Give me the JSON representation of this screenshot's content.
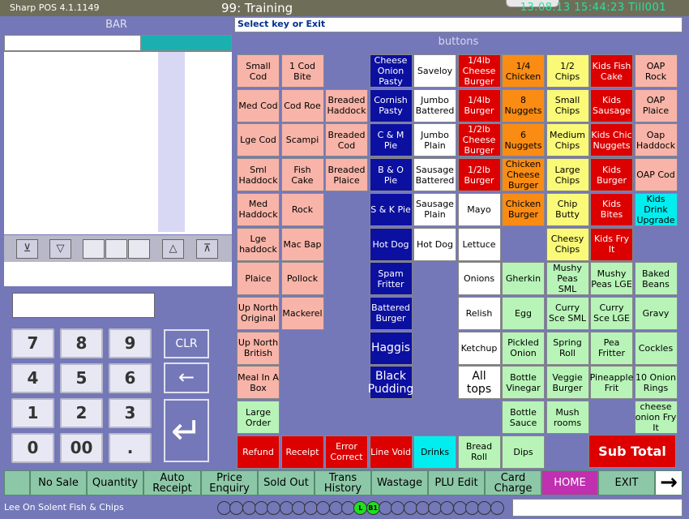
{
  "titlebar": {
    "app": "Sharp POS 4.1.1149",
    "title": "99: Training",
    "clock": "13.08.13  15:44:23  Till001"
  },
  "left": {
    "bar_label": "BAR",
    "scroll_buttons": [
      "top",
      "down",
      "",
      "",
      "",
      "up",
      "bottom"
    ],
    "keypad": [
      "7",
      "8",
      "9",
      "4",
      "5",
      "6",
      "1",
      "2",
      "3",
      "0",
      "00",
      "."
    ],
    "clr_label": "CLR",
    "backspace_label": "←",
    "enter_label": "↵"
  },
  "status": {
    "prompt": "Select key or Exit"
  },
  "buttons_label": "buttons",
  "buttons": [
    {
      "label": "Small Cod",
      "color": "pink",
      "col": 0,
      "row": 0
    },
    {
      "label": "1 Cod Bite",
      "color": "pink",
      "col": 1,
      "row": 0
    },
    {
      "label": "Cheese Onion Pasty",
      "color": "navy",
      "col": 3,
      "row": 0
    },
    {
      "label": "Saveloy",
      "color": "white",
      "col": 4,
      "row": 0
    },
    {
      "label": "1/4lb Cheese Burger",
      "color": "red",
      "col": 5,
      "row": 0
    },
    {
      "label": "1/4 Chicken",
      "color": "orange",
      "col": 6,
      "row": 0
    },
    {
      "label": "1/2 Chips",
      "color": "yellow",
      "col": 7,
      "row": 0
    },
    {
      "label": "Kids Fish Cake",
      "color": "red",
      "col": 8,
      "row": 0
    },
    {
      "label": "OAP Rock",
      "color": "pink",
      "col": 9,
      "row": 0
    },
    {
      "label": "Med Cod",
      "color": "pink",
      "col": 0,
      "row": 1
    },
    {
      "label": "Cod Roe",
      "color": "pink",
      "col": 1,
      "row": 1
    },
    {
      "label": "Breaded Haddock",
      "color": "pink",
      "col": 2,
      "row": 1
    },
    {
      "label": "Cornish Pasty",
      "color": "navy",
      "col": 3,
      "row": 1
    },
    {
      "label": "Jumbo Battered",
      "color": "white",
      "col": 4,
      "row": 1
    },
    {
      "label": "1/4lb Burger",
      "color": "red",
      "col": 5,
      "row": 1
    },
    {
      "label": "8 Nuggets",
      "color": "orange",
      "col": 6,
      "row": 1
    },
    {
      "label": "Small Chips",
      "color": "yellow",
      "col": 7,
      "row": 1
    },
    {
      "label": "Kids Sausage",
      "color": "red",
      "col": 8,
      "row": 1
    },
    {
      "label": "OAP Plaice",
      "color": "pink",
      "col": 9,
      "row": 1
    },
    {
      "label": "Lge Cod",
      "color": "pink",
      "col": 0,
      "row": 2
    },
    {
      "label": "Scampi",
      "color": "pink",
      "col": 1,
      "row": 2
    },
    {
      "label": "Breaded Cod",
      "color": "pink",
      "col": 2,
      "row": 2
    },
    {
      "label": "C & M Pie",
      "color": "navy",
      "col": 3,
      "row": 2
    },
    {
      "label": "Jumbo Plain",
      "color": "white",
      "col": 4,
      "row": 2
    },
    {
      "label": "1/2lb Cheese Burger",
      "color": "red",
      "col": 5,
      "row": 2
    },
    {
      "label": "6 Nuggets",
      "color": "orange",
      "col": 6,
      "row": 2
    },
    {
      "label": "Medium Chips",
      "color": "yellow",
      "col": 7,
      "row": 2
    },
    {
      "label": "Kids Chic Nuggets",
      "color": "red",
      "col": 8,
      "row": 2
    },
    {
      "label": "Oap Haddock",
      "color": "pink",
      "col": 9,
      "row": 2
    },
    {
      "label": "Sml Haddock",
      "color": "pink",
      "col": 0,
      "row": 3
    },
    {
      "label": "Fish Cake",
      "color": "pink",
      "col": 1,
      "row": 3
    },
    {
      "label": "Breaded Plaice",
      "color": "pink",
      "col": 2,
      "row": 3
    },
    {
      "label": "B & O Pie",
      "color": "navy",
      "col": 3,
      "row": 3
    },
    {
      "label": "Sausage Battered",
      "color": "white",
      "col": 4,
      "row": 3
    },
    {
      "label": "1/2lb Burger",
      "color": "red",
      "col": 5,
      "row": 3
    },
    {
      "label": "Chicken Cheese Burger",
      "color": "orange",
      "col": 6,
      "row": 3
    },
    {
      "label": "Large Chips",
      "color": "yellow",
      "col": 7,
      "row": 3
    },
    {
      "label": "Kids Burger",
      "color": "red",
      "col": 8,
      "row": 3
    },
    {
      "label": "OAP Cod",
      "color": "pink",
      "col": 9,
      "row": 3
    },
    {
      "label": "Med Haddock",
      "color": "pink",
      "col": 0,
      "row": 4
    },
    {
      "label": "Rock",
      "color": "pink",
      "col": 1,
      "row": 4
    },
    {
      "label": "S & K Pie",
      "color": "navy",
      "col": 3,
      "row": 4
    },
    {
      "label": "Sausage Plain",
      "color": "white",
      "col": 4,
      "row": 4
    },
    {
      "label": "Mayo",
      "color": "white",
      "col": 5,
      "row": 4
    },
    {
      "label": "Chicken Burger",
      "color": "orange",
      "col": 6,
      "row": 4
    },
    {
      "label": "Chip Butty",
      "color": "yellow",
      "col": 7,
      "row": 4
    },
    {
      "label": "Kids Bites",
      "color": "red",
      "col": 8,
      "row": 4
    },
    {
      "label": "Kids Drink Upgrade",
      "color": "cyan",
      "col": 9,
      "row": 4
    },
    {
      "label": "Lge haddock",
      "color": "pink",
      "col": 0,
      "row": 5
    },
    {
      "label": "Mac Bap",
      "color": "pink",
      "col": 1,
      "row": 5
    },
    {
      "label": "Hot Dog",
      "color": "navy",
      "col": 3,
      "row": 5
    },
    {
      "label": "Hot Dog",
      "color": "white",
      "col": 4,
      "row": 5
    },
    {
      "label": "Lettuce",
      "color": "white",
      "col": 5,
      "row": 5
    },
    {
      "label": "Cheesy Chips",
      "color": "yellow",
      "col": 7,
      "row": 5
    },
    {
      "label": "Kids Fry It",
      "color": "red",
      "col": 8,
      "row": 5
    },
    {
      "label": "Plaice",
      "color": "pink",
      "col": 0,
      "row": 6
    },
    {
      "label": "Pollock",
      "color": "pink",
      "col": 1,
      "row": 6
    },
    {
      "label": "Spam Fritter",
      "color": "navy",
      "col": 3,
      "row": 6
    },
    {
      "label": "Onions",
      "color": "white",
      "col": 5,
      "row": 6
    },
    {
      "label": "Gherkin",
      "color": "green",
      "col": 6,
      "row": 6
    },
    {
      "label": "Mushy Peas SML",
      "color": "green",
      "col": 7,
      "row": 6
    },
    {
      "label": "Mushy Peas LGE",
      "color": "green",
      "col": 8,
      "row": 6
    },
    {
      "label": "Baked Beans",
      "color": "green",
      "col": 9,
      "row": 6
    },
    {
      "label": "Up North Original",
      "color": "pink",
      "col": 0,
      "row": 7
    },
    {
      "label": "Mackerel",
      "color": "pink",
      "col": 1,
      "row": 7
    },
    {
      "label": "Battered Burger",
      "color": "navy",
      "col": 3,
      "row": 7
    },
    {
      "label": "Relish",
      "color": "white",
      "col": 5,
      "row": 7
    },
    {
      "label": "Egg",
      "color": "green",
      "col": 6,
      "row": 7
    },
    {
      "label": "Curry Sce SML",
      "color": "green",
      "col": 7,
      "row": 7
    },
    {
      "label": "Curry Sce LGE",
      "color": "green",
      "col": 8,
      "row": 7
    },
    {
      "label": "Gravy",
      "color": "green",
      "col": 9,
      "row": 7
    },
    {
      "label": "Up North British",
      "color": "pink",
      "col": 0,
      "row": 8
    },
    {
      "label": "Haggis",
      "color": "navy",
      "col": 3,
      "row": 8,
      "big": true
    },
    {
      "label": "Ketchup",
      "color": "white",
      "col": 5,
      "row": 8
    },
    {
      "label": "Pickled Onion",
      "color": "green",
      "col": 6,
      "row": 8
    },
    {
      "label": "Spring Roll",
      "color": "green",
      "col": 7,
      "row": 8
    },
    {
      "label": "Pea Fritter",
      "color": "green",
      "col": 8,
      "row": 8
    },
    {
      "label": "Cockles",
      "color": "green",
      "col": 9,
      "row": 8
    },
    {
      "label": "Meal In A Box",
      "color": "pink",
      "col": 0,
      "row": 9
    },
    {
      "label": "Black Pudding",
      "color": "navy",
      "col": 3,
      "row": 9,
      "big": true
    },
    {
      "label": "All tops",
      "color": "white",
      "col": 5,
      "row": 9,
      "big": true
    },
    {
      "label": "Bottle Vinegar",
      "color": "green",
      "col": 6,
      "row": 9
    },
    {
      "label": "Veggie Burger",
      "color": "green",
      "col": 7,
      "row": 9
    },
    {
      "label": "Pineapple Frit",
      "color": "green",
      "col": 8,
      "row": 9
    },
    {
      "label": "10 Onion Rings",
      "color": "green",
      "col": 9,
      "row": 9
    },
    {
      "label": "Large Order",
      "color": "green",
      "col": 0,
      "row": 10
    },
    {
      "label": "Bottle Sauce",
      "color": "green",
      "col": 6,
      "row": 10
    },
    {
      "label": "Mush rooms",
      "color": "green",
      "col": 7,
      "row": 10
    },
    {
      "label": "cheese onion Fry It",
      "color": "green",
      "col": 9,
      "row": 10
    },
    {
      "label": "Refund",
      "color": "red",
      "col": 0,
      "row": 11
    },
    {
      "label": "Receipt",
      "color": "red",
      "col": 1,
      "row": 11
    },
    {
      "label": "Error Correct",
      "color": "red",
      "col": 2,
      "row": 11
    },
    {
      "label": "Line Void",
      "color": "red",
      "col": 3,
      "row": 11
    },
    {
      "label": "Drinks",
      "color": "cyan",
      "col": 4,
      "row": 11
    },
    {
      "label": "Bread Roll",
      "color": "green",
      "col": 5,
      "row": 11
    },
    {
      "label": "Dips",
      "color": "green",
      "col": 6,
      "row": 11
    }
  ],
  "subtotal_label": "Sub Total",
  "function_keys": [
    {
      "label": "No Sale"
    },
    {
      "label": "Quantity"
    },
    {
      "label": "Auto Receipt"
    },
    {
      "label": "Price Enquiry"
    },
    {
      "label": "Sold Out"
    },
    {
      "label": "Trans History"
    },
    {
      "label": "Wastage"
    },
    {
      "label": "PLU Edit"
    },
    {
      "label": "Card Charge"
    },
    {
      "label": "HOME"
    },
    {
      "label": "EXIT"
    },
    {
      "label": "→"
    }
  ],
  "footer": {
    "shop_name": "Lee On Solent Fish & Chips",
    "indicators": [
      "",
      "",
      "",
      "",
      "",
      "",
      "",
      "",
      "",
      "",
      "",
      "L",
      "B1",
      "",
      "",
      "",
      "",
      "",
      "",
      "",
      "",
      "",
      ""
    ]
  },
  "colors": {
    "background": "#7478b8",
    "pink": "#f8b4a8",
    "navy": "#0c10a0",
    "red": "#dc0000",
    "orange": "#fa8c14",
    "yellow": "#fafa78",
    "green": "#b8f4b8",
    "cyan": "#00eef0",
    "function_key": "#8cc8a8",
    "home": "#c030b0"
  }
}
